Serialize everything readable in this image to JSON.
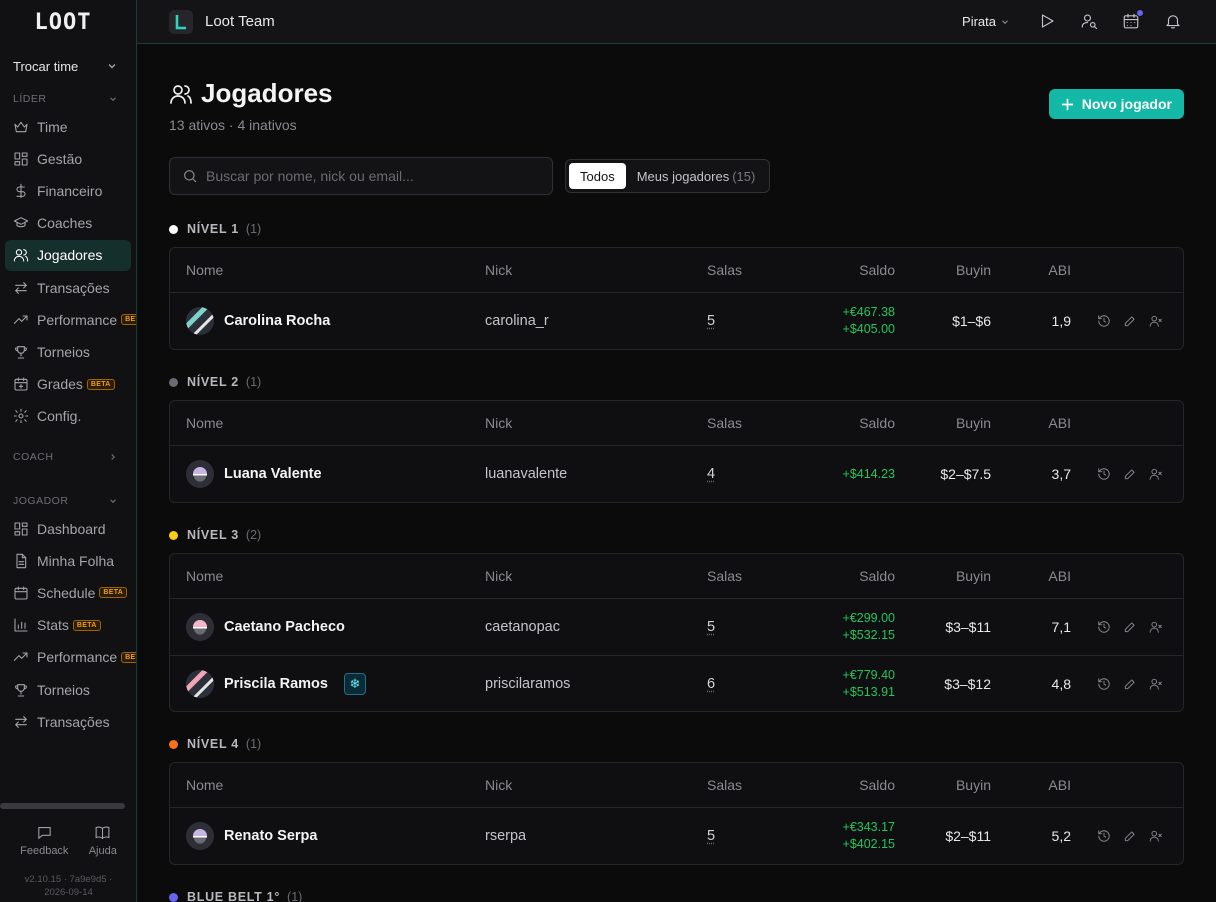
{
  "sidebar": {
    "logo": "LOOT",
    "team_switch": "Trocar time",
    "sections": {
      "lider": "LÍDER",
      "coach": "COACH",
      "jogador": "JOGADOR"
    },
    "lider_items": [
      {
        "label": "Time",
        "icon": "crown-icon"
      },
      {
        "label": "Gestão",
        "icon": "dashboard-grid-icon"
      },
      {
        "label": "Financeiro",
        "icon": "dollar-icon"
      },
      {
        "label": "Coaches",
        "icon": "graduation-cap-icon"
      },
      {
        "label": "Jogadores",
        "icon": "users-icon",
        "active": true
      },
      {
        "label": "Transações",
        "icon": "arrows-swap-icon"
      },
      {
        "label": "Performance",
        "icon": "trending-up-icon",
        "badge": "BETA"
      },
      {
        "label": "Torneios",
        "icon": "trophy-icon"
      },
      {
        "label": "Grades",
        "icon": "calendar-plus-icon",
        "badge": "BETA"
      },
      {
        "label": "Config.",
        "icon": "gear-icon"
      }
    ],
    "jogador_items": [
      {
        "label": "Dashboard",
        "icon": "dashboard-grid-icon"
      },
      {
        "label": "Minha Folha",
        "icon": "document-icon"
      },
      {
        "label": "Schedule",
        "icon": "calendar-icon",
        "badge": "BETA"
      },
      {
        "label": "Stats",
        "icon": "bar-chart-icon",
        "badge": "BETA"
      },
      {
        "label": "Performance",
        "icon": "trending-up-icon",
        "badge": "BETA"
      },
      {
        "label": "Torneios",
        "icon": "trophy-icon"
      },
      {
        "label": "Transações",
        "icon": "arrows-swap-icon"
      }
    ],
    "footer": {
      "feedback": "Feedback",
      "help": "Ajuda",
      "version_line1": "v2.10.15 · 7a9e9d5 ·",
      "version_line2": "2026-09-14"
    }
  },
  "topbar": {
    "team_name": "Loot Team",
    "user": "Pirata"
  },
  "page": {
    "title": "Jogadores",
    "subtitle": "13 ativos · 4 inativos",
    "new_button": "Novo jogador",
    "search_placeholder": "Buscar por nome, nick ou email...",
    "filter_all": "Todos",
    "filter_mine": "Meus jogadores",
    "filter_mine_count": "(15)"
  },
  "columns": {
    "name": "Nome",
    "nick": "Nick",
    "salas": "Salas",
    "saldo": "Saldo",
    "buyin": "Buyin",
    "abi": "ABI"
  },
  "groups": [
    {
      "label": "NÍVEL 1",
      "count": "(1)",
      "color": "#ffffff",
      "players": [
        {
          "name": "Carolina Rocha",
          "nick": "carolina_r",
          "salas": "5",
          "saldo": [
            "+€467.38",
            "+$405.00"
          ],
          "buyin": "$1–$6",
          "abi": "1,9",
          "avatar": "stripe-teal"
        }
      ]
    },
    {
      "label": "NÍVEL 2",
      "count": "(1)",
      "color": "#6b6b72",
      "players": [
        {
          "name": "Luana Valente",
          "nick": "luanavalente",
          "salas": "4",
          "saldo": [
            "+$414.23"
          ],
          "buyin": "$2–$7.5",
          "abi": "3,7",
          "avatar": "lavender"
        }
      ]
    },
    {
      "label": "NÍVEL 3",
      "count": "(2)",
      "color": "#facc15",
      "players": [
        {
          "name": "Caetano Pacheco",
          "nick": "caetanopac",
          "salas": "5",
          "saldo": [
            "+€299.00",
            "+$532.15"
          ],
          "buyin": "$3–$11",
          "abi": "7,1",
          "avatar": "pink"
        },
        {
          "name": "Priscila Ramos",
          "nick": "priscilaramos",
          "salas": "6",
          "saldo": [
            "+€779.40",
            "+$513.91"
          ],
          "buyin": "$3–$12",
          "abi": "4,8",
          "avatar": "stripe-pink",
          "badge": "snowflake-icon"
        }
      ]
    },
    {
      "label": "NÍVEL 4",
      "count": "(1)",
      "color": "#f97316",
      "players": [
        {
          "name": "Renato Serpa",
          "nick": "rserpa",
          "salas": "5",
          "saldo": [
            "+€343.17",
            "+$402.15"
          ],
          "buyin": "$2–$11",
          "abi": "5,2",
          "avatar": "lavender"
        }
      ]
    },
    {
      "label": "BLUE BELT 1°",
      "count": "(1)",
      "color": "#6366f1",
      "players": []
    }
  ]
}
